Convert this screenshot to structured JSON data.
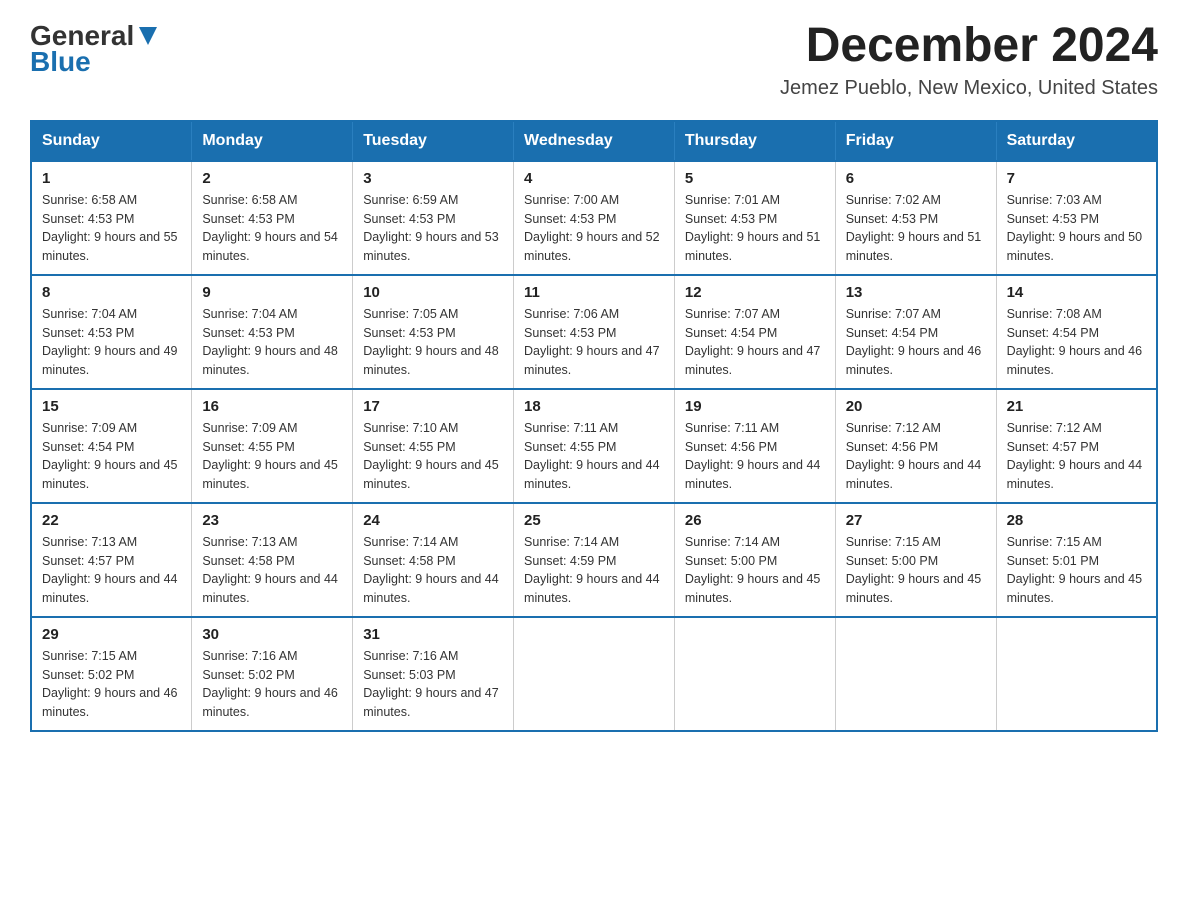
{
  "logo": {
    "general": "General",
    "blue": "Blue"
  },
  "header": {
    "month": "December 2024",
    "location": "Jemez Pueblo, New Mexico, United States"
  },
  "days_of_week": [
    "Sunday",
    "Monday",
    "Tuesday",
    "Wednesday",
    "Thursday",
    "Friday",
    "Saturday"
  ],
  "weeks": [
    [
      {
        "day": "1",
        "sunrise": "6:58 AM",
        "sunset": "4:53 PM",
        "daylight": "9 hours and 55 minutes."
      },
      {
        "day": "2",
        "sunrise": "6:58 AM",
        "sunset": "4:53 PM",
        "daylight": "9 hours and 54 minutes."
      },
      {
        "day": "3",
        "sunrise": "6:59 AM",
        "sunset": "4:53 PM",
        "daylight": "9 hours and 53 minutes."
      },
      {
        "day": "4",
        "sunrise": "7:00 AM",
        "sunset": "4:53 PM",
        "daylight": "9 hours and 52 minutes."
      },
      {
        "day": "5",
        "sunrise": "7:01 AM",
        "sunset": "4:53 PM",
        "daylight": "9 hours and 51 minutes."
      },
      {
        "day": "6",
        "sunrise": "7:02 AM",
        "sunset": "4:53 PM",
        "daylight": "9 hours and 51 minutes."
      },
      {
        "day": "7",
        "sunrise": "7:03 AM",
        "sunset": "4:53 PM",
        "daylight": "9 hours and 50 minutes."
      }
    ],
    [
      {
        "day": "8",
        "sunrise": "7:04 AM",
        "sunset": "4:53 PM",
        "daylight": "9 hours and 49 minutes."
      },
      {
        "day": "9",
        "sunrise": "7:04 AM",
        "sunset": "4:53 PM",
        "daylight": "9 hours and 48 minutes."
      },
      {
        "day": "10",
        "sunrise": "7:05 AM",
        "sunset": "4:53 PM",
        "daylight": "9 hours and 48 minutes."
      },
      {
        "day": "11",
        "sunrise": "7:06 AM",
        "sunset": "4:53 PM",
        "daylight": "9 hours and 47 minutes."
      },
      {
        "day": "12",
        "sunrise": "7:07 AM",
        "sunset": "4:54 PM",
        "daylight": "9 hours and 47 minutes."
      },
      {
        "day": "13",
        "sunrise": "7:07 AM",
        "sunset": "4:54 PM",
        "daylight": "9 hours and 46 minutes."
      },
      {
        "day": "14",
        "sunrise": "7:08 AM",
        "sunset": "4:54 PM",
        "daylight": "9 hours and 46 minutes."
      }
    ],
    [
      {
        "day": "15",
        "sunrise": "7:09 AM",
        "sunset": "4:54 PM",
        "daylight": "9 hours and 45 minutes."
      },
      {
        "day": "16",
        "sunrise": "7:09 AM",
        "sunset": "4:55 PM",
        "daylight": "9 hours and 45 minutes."
      },
      {
        "day": "17",
        "sunrise": "7:10 AM",
        "sunset": "4:55 PM",
        "daylight": "9 hours and 45 minutes."
      },
      {
        "day": "18",
        "sunrise": "7:11 AM",
        "sunset": "4:55 PM",
        "daylight": "9 hours and 44 minutes."
      },
      {
        "day": "19",
        "sunrise": "7:11 AM",
        "sunset": "4:56 PM",
        "daylight": "9 hours and 44 minutes."
      },
      {
        "day": "20",
        "sunrise": "7:12 AM",
        "sunset": "4:56 PM",
        "daylight": "9 hours and 44 minutes."
      },
      {
        "day": "21",
        "sunrise": "7:12 AM",
        "sunset": "4:57 PM",
        "daylight": "9 hours and 44 minutes."
      }
    ],
    [
      {
        "day": "22",
        "sunrise": "7:13 AM",
        "sunset": "4:57 PM",
        "daylight": "9 hours and 44 minutes."
      },
      {
        "day": "23",
        "sunrise": "7:13 AM",
        "sunset": "4:58 PM",
        "daylight": "9 hours and 44 minutes."
      },
      {
        "day": "24",
        "sunrise": "7:14 AM",
        "sunset": "4:58 PM",
        "daylight": "9 hours and 44 minutes."
      },
      {
        "day": "25",
        "sunrise": "7:14 AM",
        "sunset": "4:59 PM",
        "daylight": "9 hours and 44 minutes."
      },
      {
        "day": "26",
        "sunrise": "7:14 AM",
        "sunset": "5:00 PM",
        "daylight": "9 hours and 45 minutes."
      },
      {
        "day": "27",
        "sunrise": "7:15 AM",
        "sunset": "5:00 PM",
        "daylight": "9 hours and 45 minutes."
      },
      {
        "day": "28",
        "sunrise": "7:15 AM",
        "sunset": "5:01 PM",
        "daylight": "9 hours and 45 minutes."
      }
    ],
    [
      {
        "day": "29",
        "sunrise": "7:15 AM",
        "sunset": "5:02 PM",
        "daylight": "9 hours and 46 minutes."
      },
      {
        "day": "30",
        "sunrise": "7:16 AM",
        "sunset": "5:02 PM",
        "daylight": "9 hours and 46 minutes."
      },
      {
        "day": "31",
        "sunrise": "7:16 AM",
        "sunset": "5:03 PM",
        "daylight": "9 hours and 47 minutes."
      },
      null,
      null,
      null,
      null
    ]
  ]
}
